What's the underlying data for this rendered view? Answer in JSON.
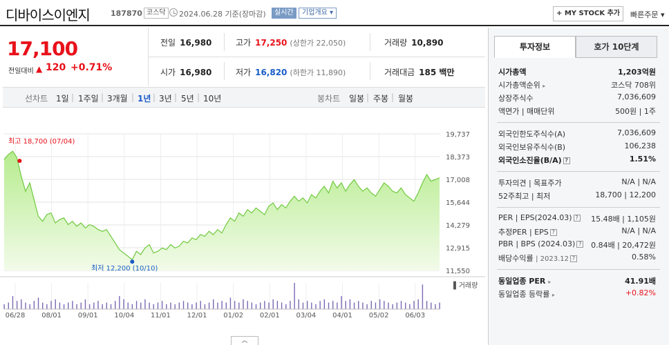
{
  "header": {
    "name": "디바이스이엔지",
    "code": "187870",
    "market": "코스닥",
    "date": "2024.06.28 기준(장마감)",
    "realtime": "실시간",
    "corp_info": "기업개요 ▾",
    "mystock": "+ MY STOCK 추가",
    "quick_order": "빠른주문 ▾"
  },
  "price": {
    "current": "17,100",
    "prev_label": "전일대비",
    "change_arrow": "▲",
    "change": "120",
    "pct": "+0.71%"
  },
  "summary": {
    "prev_close_label": "전일",
    "prev_close": "16,980",
    "open_label": "시가",
    "open": "16,980",
    "high_label": "고가",
    "high": "17,250",
    "upper_limit": "(상한가 22,050)",
    "low_label": "저가",
    "low": "16,820",
    "lower_limit": "(하한가 11,890)",
    "volume_label": "거래량",
    "volume": "10,890",
    "amount_label": "거래대금",
    "amount": "185 백만"
  },
  "period_bar": {
    "line_label": "선차트",
    "periods": [
      "1일",
      "1주일",
      "3개월",
      "1년",
      "3년",
      "5년",
      "10년"
    ],
    "selected": "1년",
    "candle_label": "봉차트",
    "candles": [
      "일봉",
      "주봉",
      "월봉"
    ]
  },
  "chart_data": {
    "type": "area",
    "y_ticks": [
      "19,737",
      "18,373",
      "17,008",
      "15,644",
      "14,279",
      "12,915",
      "11,550"
    ],
    "ylim": [
      11550,
      19737
    ],
    "x_ticks": [
      "06/28",
      "08/01",
      "09/01",
      "10/04",
      "11/01",
      "12/01",
      "01/02",
      "02/01",
      "03/04",
      "04/01",
      "05/02",
      "06/03"
    ],
    "high_annotation": "최고 18,700 (07/04)",
    "low_annotation": "최저 12,200 (10/10)",
    "volume_label": "거래량",
    "series": [
      {
        "values": [
          18200,
          18500,
          18700,
          18300,
          17200,
          16300,
          16800,
          15800,
          14800,
          14500,
          14900,
          15000,
          14400,
          14600,
          14700,
          14300,
          14500,
          14200,
          14400,
          14100,
          14300,
          14200,
          14000,
          13900,
          14000,
          13600,
          13200,
          12800,
          12600,
          12400,
          12200,
          12700,
          12500,
          12900,
          13100,
          12600,
          12700,
          12900,
          12800,
          13100,
          12900,
          13000,
          13300,
          13200,
          13500,
          13400,
          13700,
          13600,
          13900,
          13700,
          14000,
          13800,
          14300,
          14700,
          14500,
          15000,
          14800,
          15200,
          15000,
          15300,
          15100,
          14900,
          15400,
          15600,
          15200,
          15500,
          15300,
          15700,
          16000,
          15700,
          15900,
          15600,
          16100,
          15900,
          16300,
          16600,
          16200,
          16900,
          16500,
          16800,
          16300,
          16700,
          17000,
          16600,
          16300,
          16500,
          16200,
          16000,
          16400,
          16800,
          16600,
          16300,
          16200,
          16500,
          16100,
          15900,
          15700,
          16200,
          16800,
          17300,
          16900,
          17000,
          17100
        ]
      }
    ],
    "volume": [
      3,
      4,
      8,
      5,
      6,
      4,
      3,
      5,
      7,
      4,
      3,
      5,
      6,
      4,
      3,
      4,
      5,
      3,
      4,
      6,
      3,
      4,
      5,
      3,
      4,
      3,
      5,
      8,
      6,
      4,
      3,
      5,
      4,
      6,
      4,
      3,
      4,
      5,
      3,
      4,
      3,
      4,
      5,
      4,
      3,
      4,
      5,
      3,
      4,
      6,
      4,
      5,
      4,
      7,
      5,
      4,
      6,
      5,
      4,
      3,
      4,
      5,
      4,
      6,
      5,
      4,
      3,
      5,
      16,
      6,
      4,
      5,
      4,
      3,
      5,
      6,
      4,
      5,
      4,
      8,
      5,
      6,
      4,
      5,
      4,
      3,
      5,
      4,
      6,
      5,
      4,
      3,
      4,
      5,
      4,
      3,
      5,
      6,
      15,
      5,
      4,
      3,
      4
    ]
  },
  "info_panel": {
    "tabs": [
      "투자정보",
      "호가 10단계"
    ],
    "market_cap_label": "시가총액",
    "market_cap": "1,203억원",
    "rank_label": "시가총액순위",
    "rank": "코스닥 708위",
    "shares_label": "상장주식수",
    "shares": "7,036,609",
    "par_label": "액면가 | 매매단위",
    "par": "500원 | 1주",
    "foreign_limit_label": "외국인한도주식수(A)",
    "foreign_limit": "7,036,609",
    "foreign_hold_label": "외국인보유주식수(B)",
    "foreign_hold": "106,238",
    "foreign_ratio_label": "외국인소진율(B/A)",
    "foreign_ratio": "1.51%",
    "opinion_label": "투자의견 | 목표주가",
    "opinion": "N/A | N/A",
    "w52_label": "52주최고 | 최저",
    "w52": "18,700 | 12,200",
    "per_label": "PER | EPS(2024.03)",
    "per": "15.48배 | 1,105원",
    "est_per_label": "추정PER | EPS",
    "est_per": "N/A | N/A",
    "pbr_label": "PBR | BPS (2024.03)",
    "pbr": "0.84배 | 20,472원",
    "div_label": "배당수익률",
    "div_date": "2023.12",
    "div": "0.58%",
    "sector_per_label": "동일업종 PER",
    "sector_per": "41.91배",
    "sector_change_label": "동일업종 등락률",
    "sector_change": "+0.82%"
  },
  "colors": {
    "up": "#e8111a",
    "down": "#1a5cc8",
    "area_fill": "#b6ec8e",
    "area_line": "#6fc93e"
  }
}
